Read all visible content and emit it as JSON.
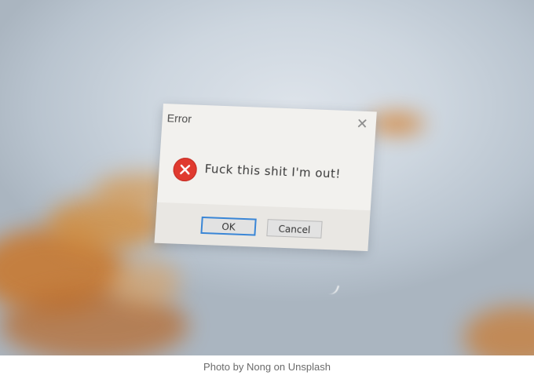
{
  "dialog": {
    "title": "Error",
    "close_icon": "close-icon",
    "icon": "error-icon",
    "message": "Fuck this shit I'm out!",
    "ok_label": "OK",
    "cancel_label": "Cancel"
  },
  "caption": "Photo by Nong on Unsplash",
  "colors": {
    "error_red": "#e03a2f",
    "focus_blue": "#3a86d6",
    "dialog_bg": "#f2f1ee",
    "footer_bg": "#e9e7e3",
    "wallpaper": "#cdd6df",
    "plant_orange": "#d9862a"
  }
}
